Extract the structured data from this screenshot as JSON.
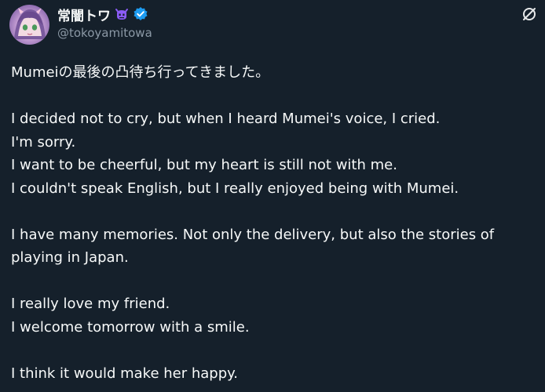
{
  "author": {
    "display_name": "常闇トワ",
    "handle": "@tokoyamitowa",
    "name_emoji": "purple-devil-icon",
    "verified": true
  },
  "icons": {
    "more": "grok-slash-circle-icon",
    "avatar": "avatar"
  },
  "colors": {
    "background": "#15202b",
    "text": "#f7f9f9",
    "muted": "#8b98a5",
    "verified": "#1d9bf0",
    "emoji": "#8b5cf6"
  },
  "tweet": {
    "p1": "Mumeiの最後の凸待ち行ってきました。",
    "p2": [
      "I decided not to cry, but when I heard Mumei's voice, I cried.",
      "I'm sorry.",
      "I want to be cheerful, but my heart is still not with me.",
      "I couldn't speak English, but I really enjoyed being with Mumei."
    ],
    "p3": "I have many memories. Not only the delivery, but also the stories of playing in Japan.",
    "p4": [
      "I really love my friend.",
      "I welcome tomorrow with a smile."
    ],
    "p5": "I think it would make her happy."
  }
}
